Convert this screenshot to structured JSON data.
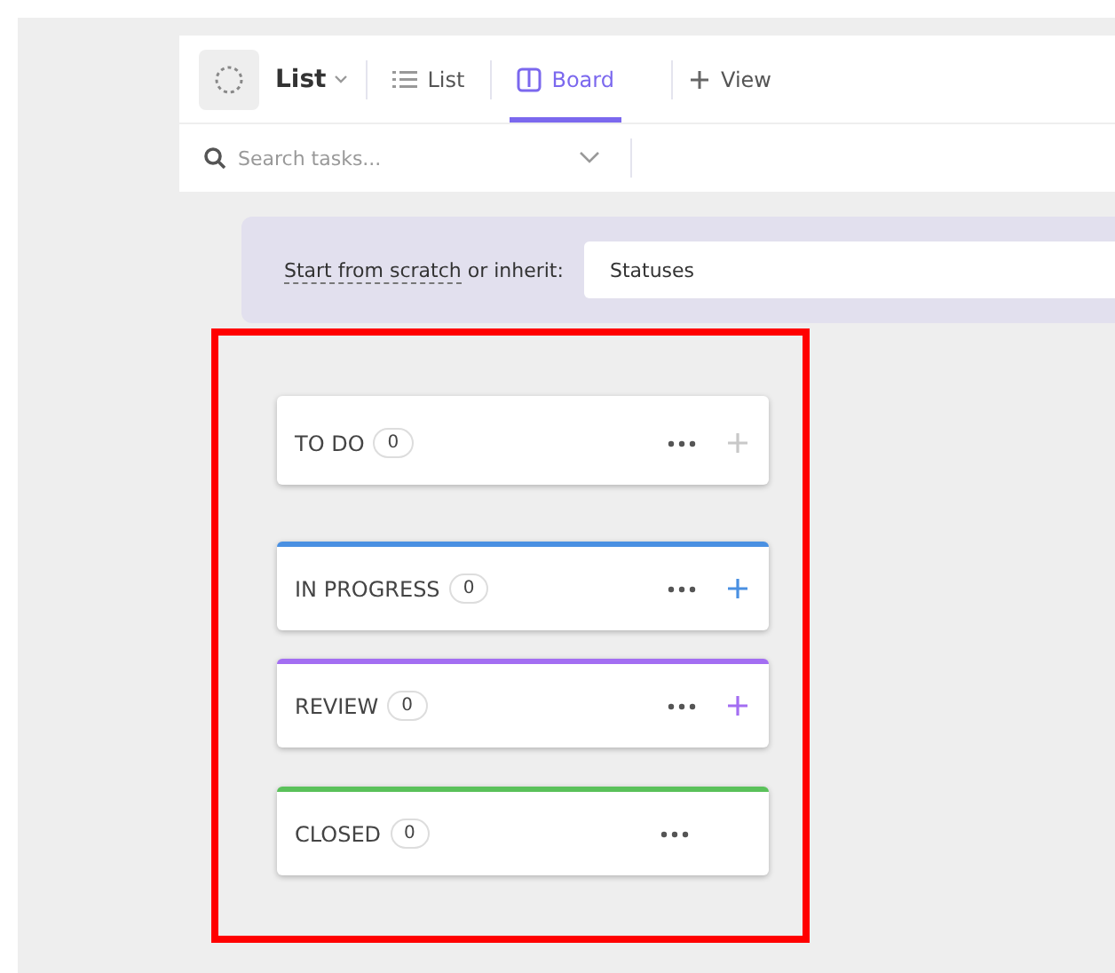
{
  "header": {
    "space_title": "List",
    "views": [
      {
        "label": "List",
        "kind": "list",
        "selected": false
      },
      {
        "label": "Board",
        "kind": "board",
        "selected": true
      }
    ],
    "add_view": "View"
  },
  "search": {
    "placeholder": "Search tasks..."
  },
  "banner": {
    "label": "Start from scratch",
    "label_rest": " or inherit:",
    "select_value": "Statuses"
  },
  "statuses": [
    {
      "name": "TO DO",
      "count": "0",
      "add_button": true
    },
    {
      "name": "IN PROGRESS",
      "count": "0",
      "color": "#4a90e2",
      "add_button": true
    },
    {
      "name": "REVIEW",
      "count": "0",
      "color": "#a36ef2",
      "add_button": true
    },
    {
      "name": "CLOSED",
      "count": "0",
      "color": "#5ac15a",
      "add_button": false
    }
  ]
}
